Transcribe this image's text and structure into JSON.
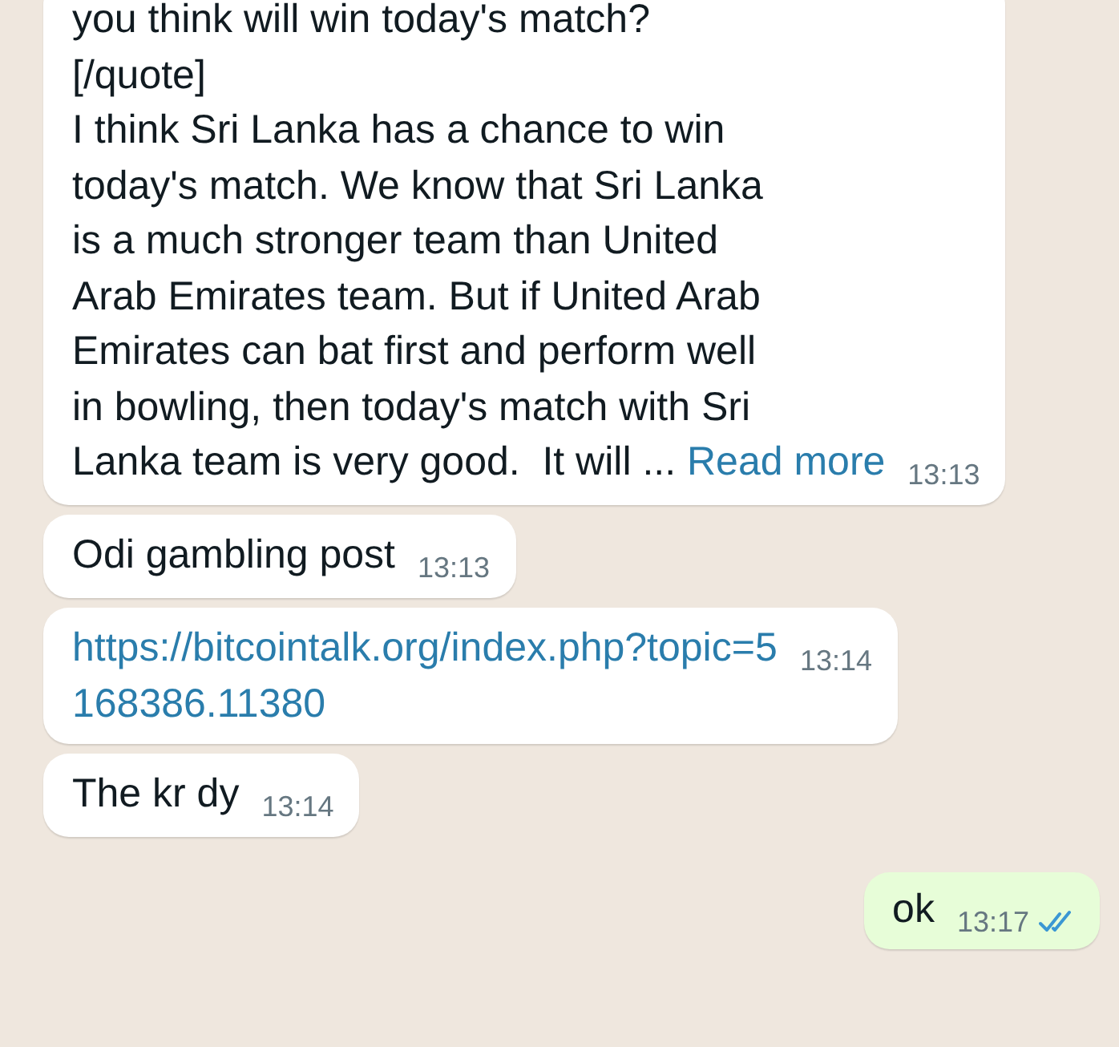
{
  "messages": [
    {
      "outgoing": false,
      "lines": [
        "you think will win today's match?",
        "[/quote]",
        "I think Sri Lanka has a chance to win",
        "today's match. We know that Sri Lanka",
        "is a much stronger team than United",
        "Arab Emirates team. But if United Arab",
        "Emirates can bat first and perform well",
        "in bowling, then today's match with Sri",
        "Lanka team is very good.  It will ... "
      ],
      "link": "Read more",
      "time": "13:13"
    },
    {
      "outgoing": false,
      "lines": [
        "Odi gambling post"
      ],
      "time": "13:13"
    },
    {
      "outgoing": false,
      "url": "https://bitcointalk.org/index.php?topic=5168386.11380",
      "time": "13:14"
    },
    {
      "outgoing": false,
      "lines": [
        "The kr dy"
      ],
      "time": "13:14"
    },
    {
      "outgoing": true,
      "lines": [
        "ok"
      ],
      "time": "13:17",
      "read": true
    }
  ]
}
